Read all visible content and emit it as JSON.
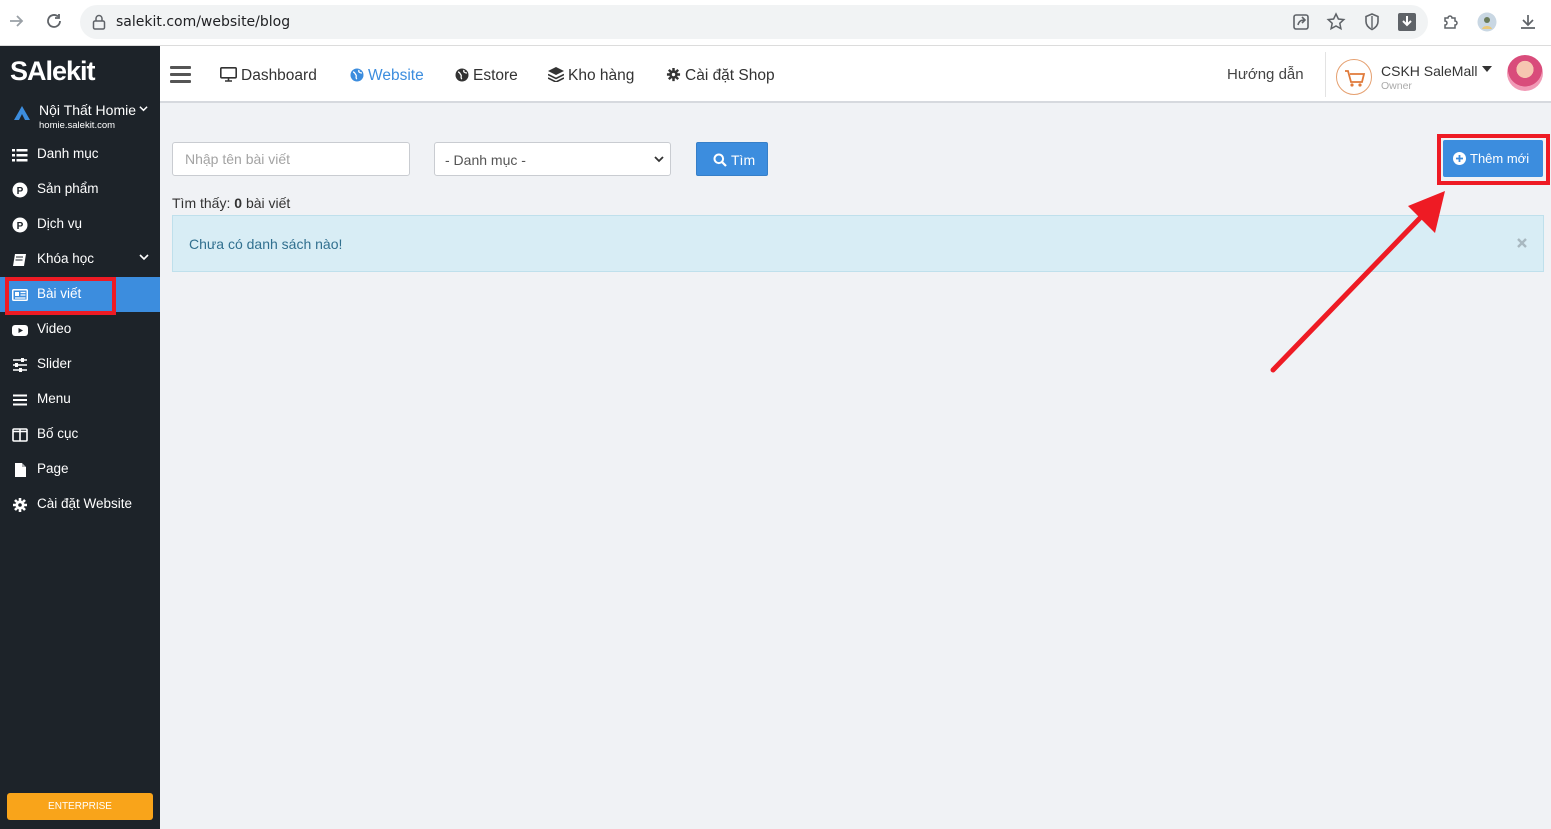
{
  "browser": {
    "url": "salekit.com/website/blog"
  },
  "sidebar": {
    "logo": "SAlekit",
    "shop": {
      "name": "Nội Thất Homie",
      "domain": "homie.salekit.com"
    },
    "items": [
      {
        "label": "Danh mục",
        "icon": "list-icon"
      },
      {
        "label": "Sản phẩm",
        "icon": "product-circle-icon"
      },
      {
        "label": "Dịch vụ",
        "icon": "service-circle-icon"
      },
      {
        "label": "Khóa học",
        "icon": "book-icon"
      },
      {
        "label": "Bài viết",
        "icon": "newspaper-icon"
      },
      {
        "label": "Video",
        "icon": "youtube-icon"
      },
      {
        "label": "Slider",
        "icon": "sliders-icon"
      },
      {
        "label": "Menu",
        "icon": "bars-icon"
      },
      {
        "label": "Bố cục",
        "icon": "columns-icon"
      },
      {
        "label": "Page",
        "icon": "file-icon"
      },
      {
        "label": "Cài đặt Website",
        "icon": "gear-icon"
      }
    ],
    "enterprise_label": "ENTERPRISE"
  },
  "topnav": {
    "links": [
      {
        "label": "Dashboard",
        "icon": "desktop-icon"
      },
      {
        "label": "Website",
        "icon": "globe-icon"
      },
      {
        "label": "Estore",
        "icon": "globe-icon"
      },
      {
        "label": "Kho hàng",
        "icon": "layers-icon"
      },
      {
        "label": "Cài đặt Shop",
        "icon": "gear-icon"
      }
    ],
    "guide": "Hướng dẫn",
    "account": {
      "name": "CSKH SaleMall",
      "role": "Owner"
    }
  },
  "filters": {
    "search_placeholder": "Nhập tên bài viết",
    "category_selected": "- Danh mục -",
    "search_button": "Tìm",
    "add_button": "Thêm mới"
  },
  "results": {
    "prefix": "Tìm thấy:",
    "count": "0",
    "suffix": "bài viết",
    "empty_message": "Chưa có danh sách nào!"
  },
  "colors": {
    "accent": "#3c8dde",
    "sidebar_bg": "#1d2329",
    "annotation_red": "#ee1b24",
    "enterprise": "#f9a41a"
  }
}
